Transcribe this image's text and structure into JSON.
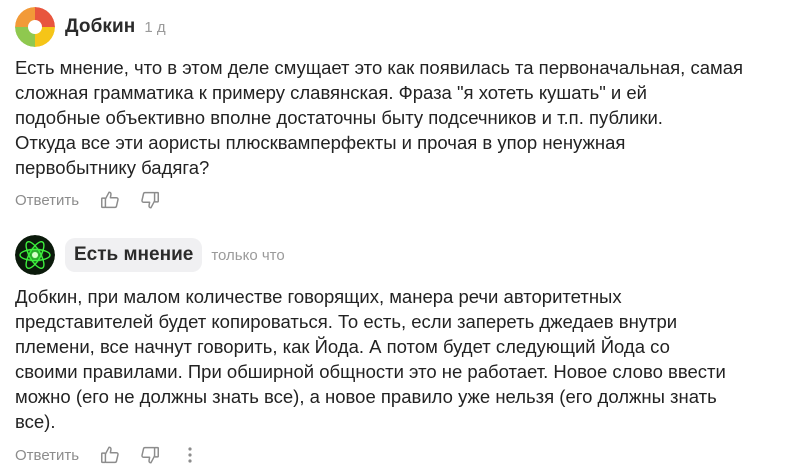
{
  "comments": [
    {
      "author": "Добкин",
      "time": "1 д",
      "lines": [
        "Есть мнение, что в этом деле смущает это как появилась та первоначальная, самая",
        "сложная грамматика к примеру славянская. Фраза \"я хотеть кушать\" и ей",
        "подобные объективно вполне достаточны быту подсечников и т.п. публики.",
        "Откуда все эти аористы плюсквамперфекты и прочая в упор ненужная",
        "первобытнику бадяга?"
      ],
      "reply_label": "Ответить",
      "like_icon": "thumbs-up-icon",
      "dislike_icon": "thumbs-down-icon",
      "avatar_colors": [
        "#f29a38",
        "#e8553e",
        "#f5c518",
        "#8fc84f"
      ]
    },
    {
      "author": "Есть мнение",
      "time": "только что",
      "lines": [
        "Добкин, при малом количестве говорящих, манера речи авторитетных",
        "представителей будет копироваться. То есть, если запереть джедаев внутри",
        "племени, все начнут говорить, как Йода. А потом будет следующий Йода со",
        "своими правилами. При обширной общности это не работает. Новое слово ввести",
        "можно (его не должны знать все), а новое правило уже нельзя (его должны знать",
        "все)."
      ],
      "reply_label": "Ответить",
      "like_icon": "thumbs-up-icon",
      "dislike_icon": "thumbs-down-icon",
      "more_icon": "more-vertical-icon",
      "avatar_colors": [
        "#0b1a0b",
        "#3df03d"
      ]
    }
  ]
}
